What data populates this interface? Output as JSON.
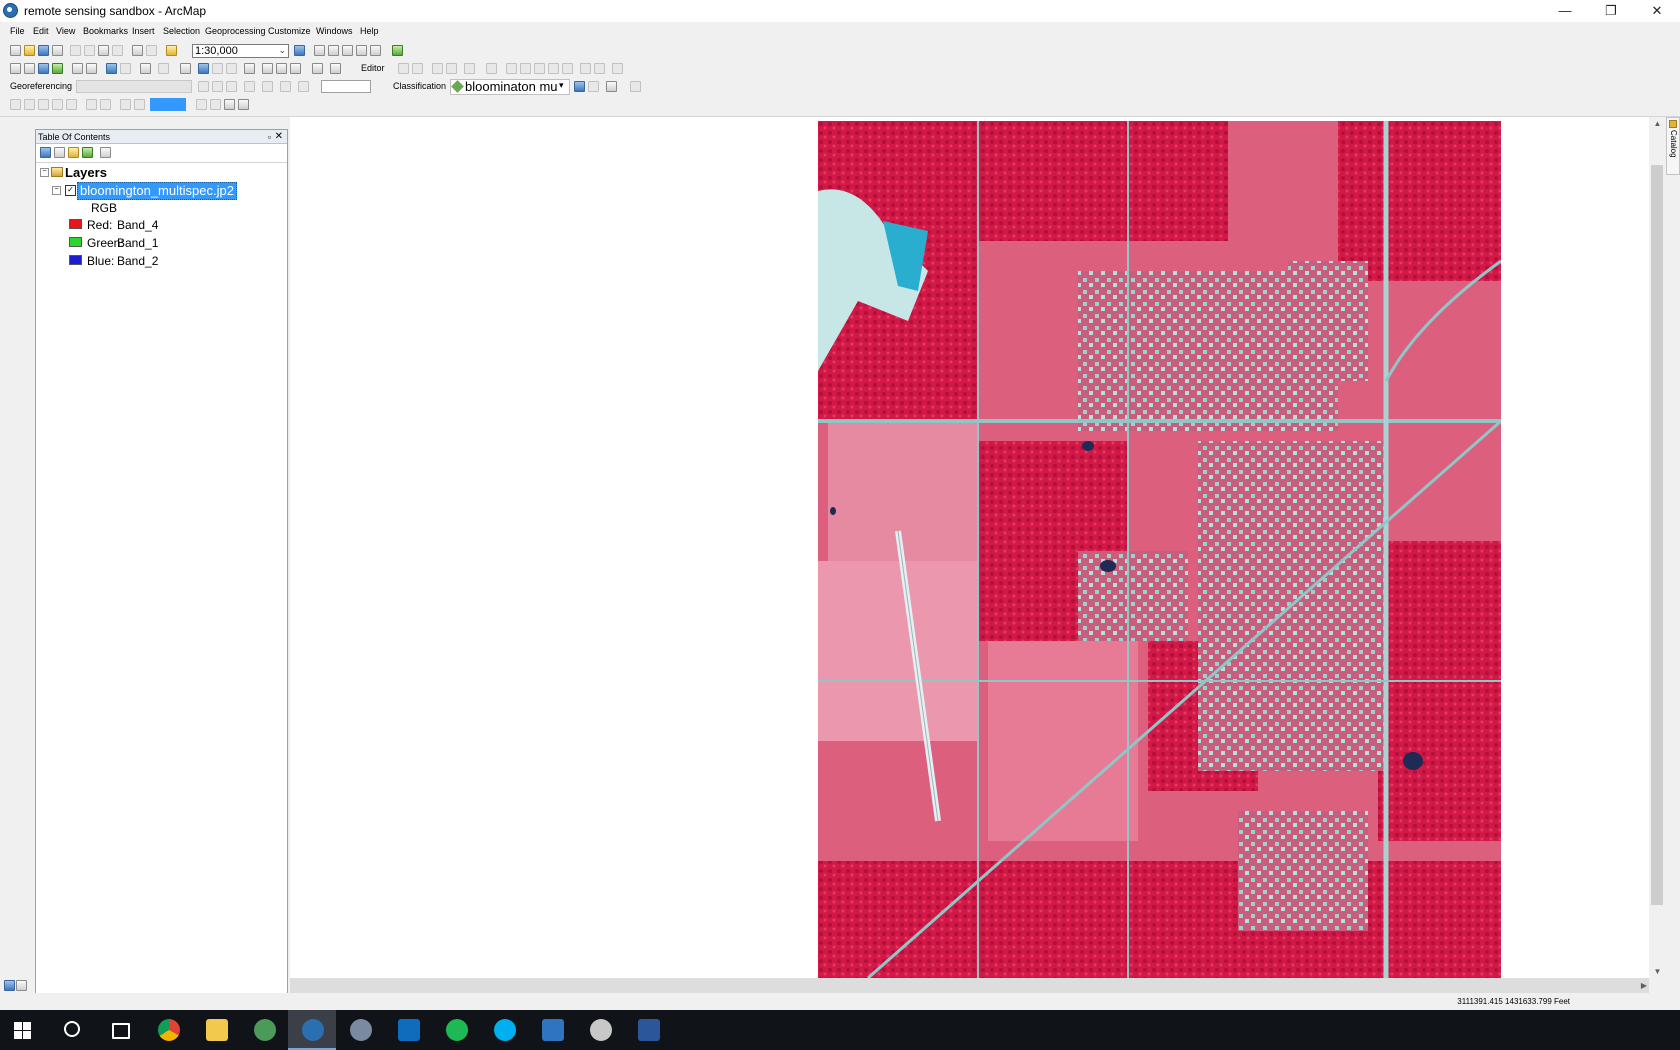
{
  "window": {
    "title": "remote sensing sandbox - ArcMap",
    "minimize": "—",
    "restore": "❐",
    "close": "✕"
  },
  "menu": [
    "File",
    "Edit",
    "View",
    "Bookmarks",
    "Insert",
    "Selection",
    "Geoprocessing",
    "Customize",
    "Windows",
    "Help"
  ],
  "toolbar": {
    "scale_value": "1:30,000",
    "editor_label": "Editor",
    "georeferencing_label": "Georeferencing",
    "classification_label": "Classification",
    "layer_combo_value": "bloominaton mu"
  },
  "toc": {
    "title": "Table Of Contents",
    "root_label": "Layers",
    "layer_name": "bloomington_multispec.jp2",
    "render_label": "RGB",
    "bands": [
      {
        "channel": "Red:",
        "band": "Band_4",
        "color": "#e8151b"
      },
      {
        "channel": "Green:",
        "band": "Band_1",
        "color": "#2bd62b"
      },
      {
        "channel": "Blue:",
        "band": "Band_2",
        "color": "#1c1cd0"
      }
    ]
  },
  "catalog_tab": "Catalog",
  "status": {
    "coordinates": "3111391.415  1431633.799 Feet"
  },
  "taskbar": {
    "apps": [
      "windows-start",
      "search",
      "task-view",
      "chrome",
      "file-explorer",
      "arcgis-earth",
      "arcmap",
      "r-studio",
      "outlook",
      "spotify",
      "skype",
      "matlab",
      "snipping-tool",
      "word"
    ]
  },
  "colors": {
    "vegetation": "#d81b4a",
    "urban": "#8fc7c7",
    "selection": "#3399ff",
    "taskbar": "#101418"
  }
}
